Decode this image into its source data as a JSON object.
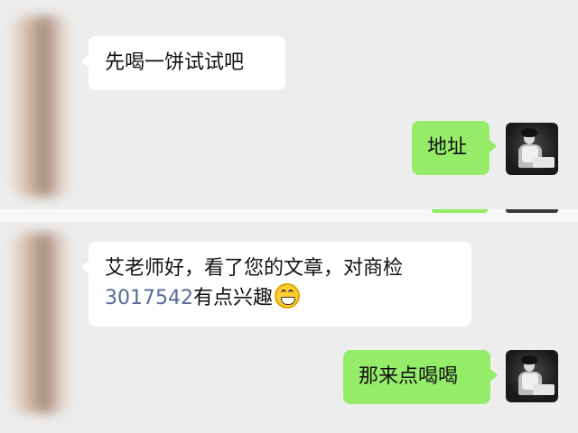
{
  "chat_top": {
    "messages": [
      {
        "sender": "other",
        "text": "先喝一饼试试吧"
      },
      {
        "sender": "me",
        "text": "地址"
      }
    ]
  },
  "chat_bottom": {
    "messages": [
      {
        "sender": "other",
        "text_line1": "艾老师好，看了您的文章，对商检",
        "number": "3017542",
        "text_after_number": "有点兴趣",
        "emoji": "grinning-face-icon"
      },
      {
        "sender": "me",
        "text": "那来点喝喝"
      }
    ]
  },
  "colors": {
    "background": "#ededed",
    "incoming_bubble": "#ffffff",
    "outgoing_bubble": "#95ec69",
    "link_number": "#576b95"
  }
}
